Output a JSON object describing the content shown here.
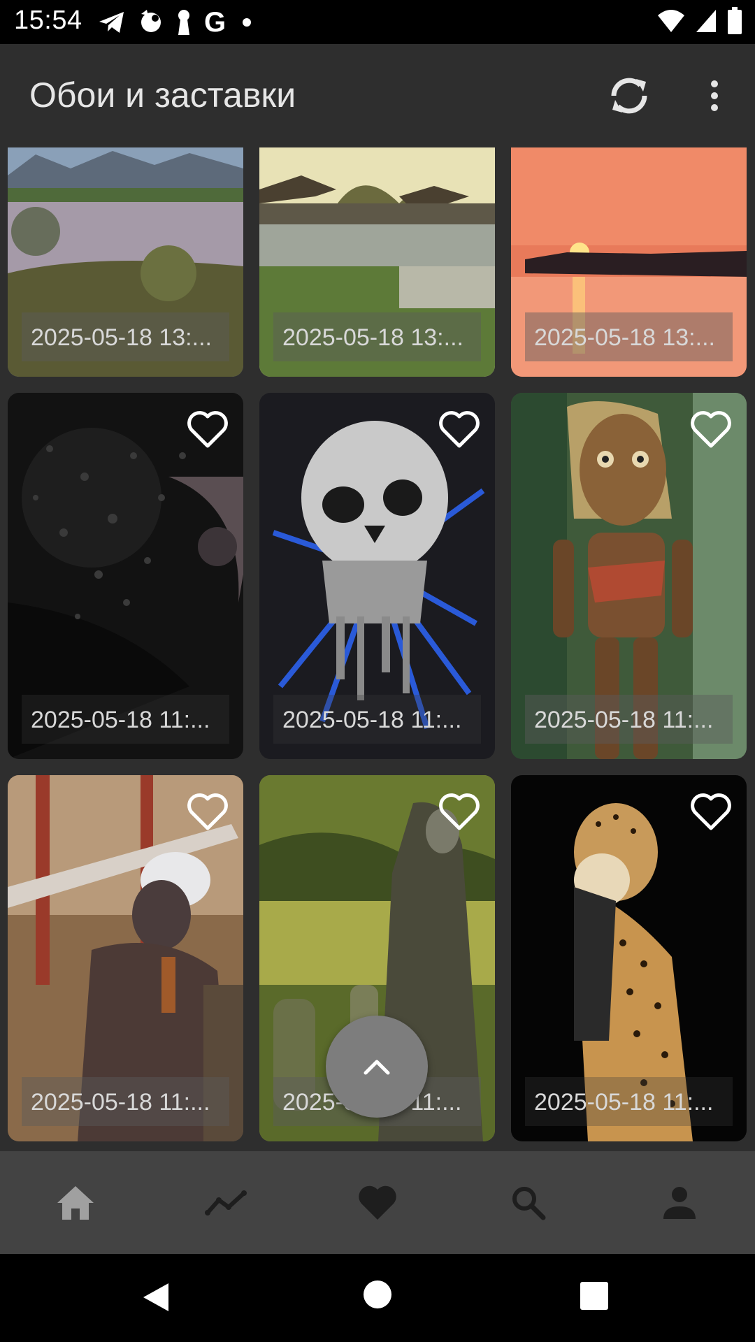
{
  "status_bar": {
    "time": "15:54"
  },
  "app_bar": {
    "title": "Обои и заставки"
  },
  "wallpapers": [
    {
      "date": "2025-05-18 13:...",
      "favorite_visible": false
    },
    {
      "date": "2025-05-18 13:...",
      "favorite_visible": false
    },
    {
      "date": "2025-05-18 13:...",
      "favorite_visible": false
    },
    {
      "date": "2025-05-18 11:...",
      "favorite_visible": true
    },
    {
      "date": "2025-05-18 11:...",
      "favorite_visible": true
    },
    {
      "date": "2025-05-18 11:...",
      "favorite_visible": true
    },
    {
      "date": "2025-05-18 11:...",
      "favorite_visible": true
    },
    {
      "date": "2025-05-18 11:...",
      "favorite_visible": true
    },
    {
      "date": "2025-05-18 11:...",
      "favorite_visible": true
    }
  ],
  "bottom_nav": {
    "items": [
      {
        "icon": "home-icon"
      },
      {
        "icon": "trending-icon"
      },
      {
        "icon": "heart-icon"
      },
      {
        "icon": "search-icon"
      },
      {
        "icon": "person-icon"
      }
    ]
  },
  "colors": {
    "background": "#2e2e2e",
    "bottom_nav": "#434343",
    "fab": "#7d7d7d",
    "icon_inactive": "#a0a0a0",
    "icon_active": "#1e1e1e"
  }
}
